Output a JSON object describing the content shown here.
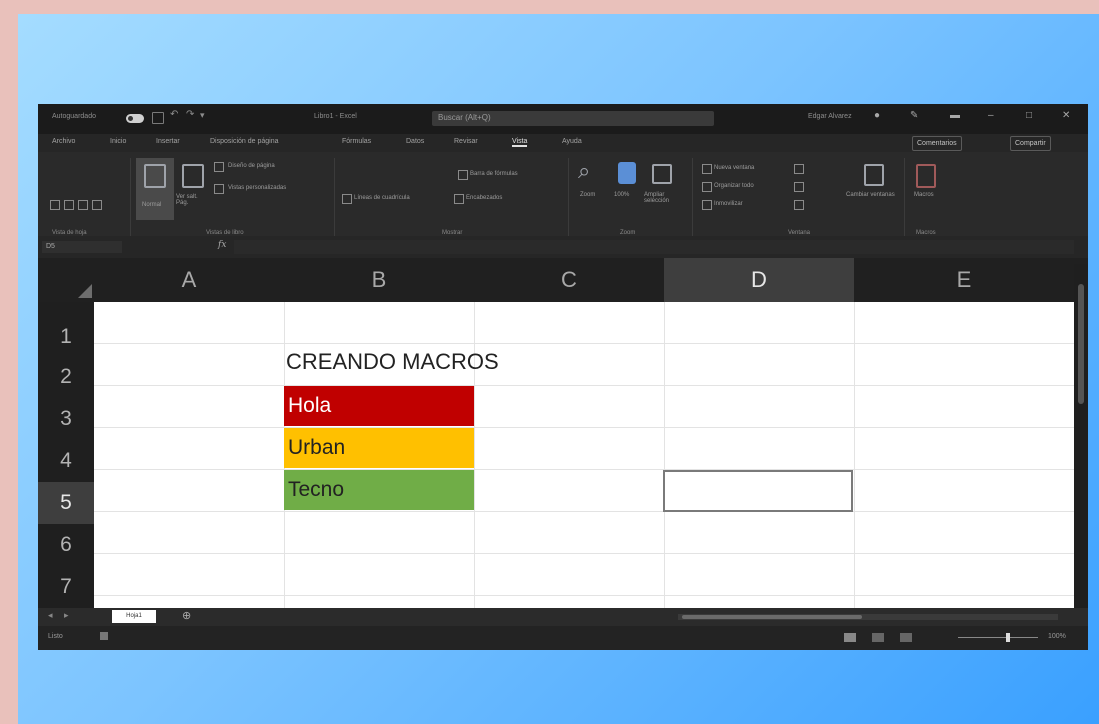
{
  "app": {
    "autosave_label": "Autoguardado",
    "file_title": "Libro1 - Excel",
    "search_placeholder": "Buscar (Alt+Q)",
    "user_name": "Edgar Alvarez"
  },
  "menu": {
    "items": [
      "Archivo",
      "Inicio",
      "Insertar",
      "Disposición de página",
      "Fórmulas",
      "Datos",
      "Revisar",
      "Vista",
      "Ayuda"
    ],
    "comments_label": "Comentarios",
    "share_label": "Compartir"
  },
  "ribbon": {
    "groups": [
      "Vista de hoja",
      "Vistas de libro",
      "Mostrar",
      "Zoom",
      "Ventana",
      "Macros"
    ],
    "normal_label": "Normal",
    "page_break_label": "Ver salt. Pág.",
    "page_layout_label": "Diseño de página",
    "custom_views_label": "Vistas personalizadas",
    "formula_bar_label": "Barra de fórmulas",
    "gridlines_label": "Líneas de cuadrícula",
    "headings_label": "Encabezados",
    "zoom_label": "Zoom",
    "zoom100_label": "100%",
    "zoom_sel_label": "Ampliar selección",
    "new_window_label": "Nueva ventana",
    "arrange_label": "Organizar todo",
    "freeze_label": "Inmovilizar",
    "switch_label": "Cambiar ventanas",
    "macros_label": "Macros"
  },
  "formula_bar": {
    "name_box": "D5",
    "fx": "fx",
    "value": ""
  },
  "grid": {
    "columns": [
      "A",
      "B",
      "C",
      "D",
      "E"
    ],
    "rows": [
      "1",
      "2",
      "3",
      "4",
      "5",
      "6",
      "7"
    ],
    "selected_column": "D",
    "selected_row": "5",
    "active_cell": "D5"
  },
  "cells": {
    "b2": "CREANDO MACROS",
    "b3": "Hola",
    "b4": "Urban",
    "b5": "Tecno"
  },
  "colors": {
    "b3_fill": "#c00000",
    "b4_fill": "#ffc000",
    "b5_fill": "#70ad47"
  },
  "tabs": {
    "sheet_name": "Hoja1",
    "add_icon": "⊕"
  },
  "status": {
    "ready": "Listo",
    "zoom": "100%"
  }
}
